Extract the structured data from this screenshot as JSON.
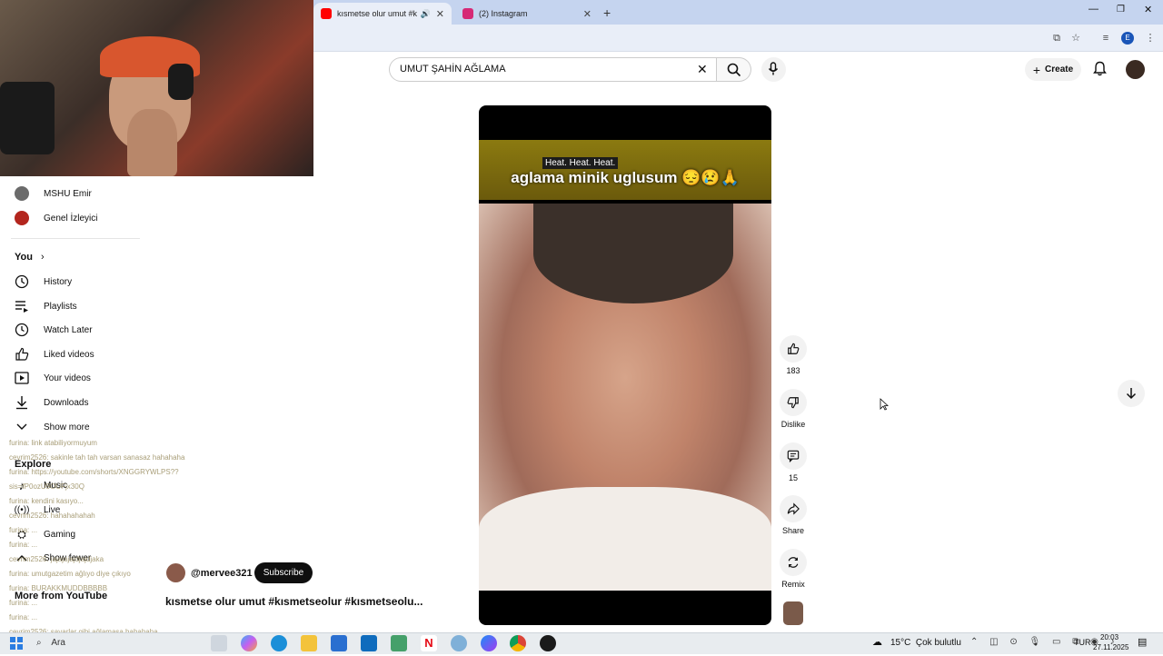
{
  "browser": {
    "tabs": [
      {
        "title": "kısmetse olur umut #kısmet",
        "active": true,
        "fav_color": "#ff0000"
      },
      {
        "title": "(2) Instagram",
        "active": false,
        "fav_color": "#d62976"
      }
    ]
  },
  "search": {
    "query": "UMUT ŞAHİN AĞLAMA"
  },
  "header": {
    "create_label": "Create"
  },
  "sidebar": {
    "subscriptions": [
      {
        "label": "MSHU Emir"
      },
      {
        "label": "Genel İzleyici"
      }
    ],
    "you_heading": "You",
    "you_items": [
      {
        "label": "History",
        "icon": "history-icon"
      },
      {
        "label": "Playlists",
        "icon": "playlists-icon"
      },
      {
        "label": "Watch Later",
        "icon": "watch-later-icon"
      },
      {
        "label": "Liked videos",
        "icon": "like-icon"
      },
      {
        "label": "Your videos",
        "icon": "video-icon"
      },
      {
        "label": "Downloads",
        "icon": "download-icon"
      },
      {
        "label": "Show more",
        "icon": "chevron-down-icon"
      }
    ],
    "explore_heading": "Explore",
    "explore_items": [
      {
        "label": "Music"
      },
      {
        "label": "Live"
      },
      {
        "label": "Gaming"
      },
      {
        "label": "Show fewer"
      }
    ],
    "more_heading": "More from YouTube"
  },
  "chat": [
    "furina: link atabiliyormuyum",
    "cevrim2526: sakinle tah tah varsan sanasaz hahahaha",
    "furina: https://youtube.com/shorts/XNGGRYWLPS??",
    "sis=fP0ozU9OUFjx30Q",
    "furina: kendini kasıyo...",
    "cevrim2526: hahahahahah",
    "furina: ...",
    "furina: ...",
    "cevrim2526: jajajajajdjajdjaka",
    "furina: umutgazetim ağlıyo diye çıkıyo",
    "furina: BURAKKMUDDBBBBB",
    "furina: ...",
    "furina: ...",
    "cevrim2526: sayarlar gibi ağlamasa hahahaha"
  ],
  "video": {
    "caption_small": "Heat. Heat. Heat.",
    "caption_main": "aglama minik uglusum 😔😢🙏",
    "channel": "@mervee321",
    "subscribe_label": "Subscribe",
    "title": "kısmetse olur umut #kısmetseolur #kısmetseolu..."
  },
  "actions": {
    "like_count": "183",
    "dislike_label": "Dislike",
    "comment_count": "15",
    "share_label": "Share",
    "remix_label": "Remix"
  },
  "taskbar": {
    "search_label": "Ara",
    "weather": "15°C  Çok bulutlu",
    "language": "TUR",
    "time": "20:03",
    "date": "27.11.2025"
  }
}
